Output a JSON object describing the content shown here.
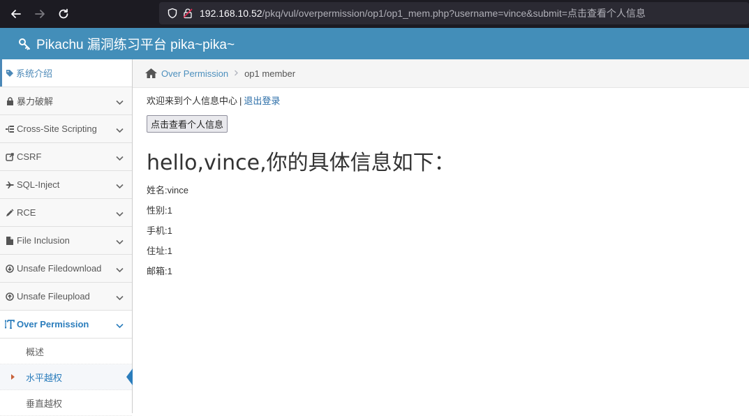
{
  "browser": {
    "url_host": "192.168.10.52",
    "url_path": "/pkq/vul/overpermission/op1/op1_mem.php?username=vince&submit=点击查看个人信息"
  },
  "header": {
    "title": "Pikachu 漏洞练习平台 pika~pika~"
  },
  "sidebar": {
    "items": [
      {
        "label": "系统介绍",
        "icon": "tag-icon"
      },
      {
        "label": "暴力破解",
        "icon": "lock-icon"
      },
      {
        "label": "Cross-Site Scripting",
        "icon": "sitemap-icon"
      },
      {
        "label": "CSRF",
        "icon": "external-link-icon"
      },
      {
        "label": "SQL-Inject",
        "icon": "plane-icon"
      },
      {
        "label": "RCE",
        "icon": "pencil-icon"
      },
      {
        "label": "File Inclusion",
        "icon": "file-icon"
      },
      {
        "label": "Unsafe Filedownload",
        "icon": "download-icon"
      },
      {
        "label": "Unsafe Fileupload",
        "icon": "upload-icon"
      },
      {
        "label": "Over Permission",
        "icon": "text-height-icon"
      }
    ],
    "subitems": [
      {
        "label": "概述"
      },
      {
        "label": "水平越权"
      },
      {
        "label": "垂直越权"
      }
    ]
  },
  "breadcrumb": {
    "link": "Over Permission",
    "current": "op1 member"
  },
  "main": {
    "welcome_text": "欢迎来到个人信息中心",
    "separator": "|",
    "logout_link": "退出登录",
    "view_button": "点击查看个人信息",
    "hello": "hello,vince,你的具体信息如下：",
    "fields": [
      "姓名:vince",
      "性别:1",
      "手机:1",
      "住址:1",
      "邮箱:1"
    ]
  },
  "colors": {
    "header": "#438eb9",
    "browser_bar": "#1c1b22",
    "accent": "#2b7dbc",
    "caret": "#c86139"
  }
}
